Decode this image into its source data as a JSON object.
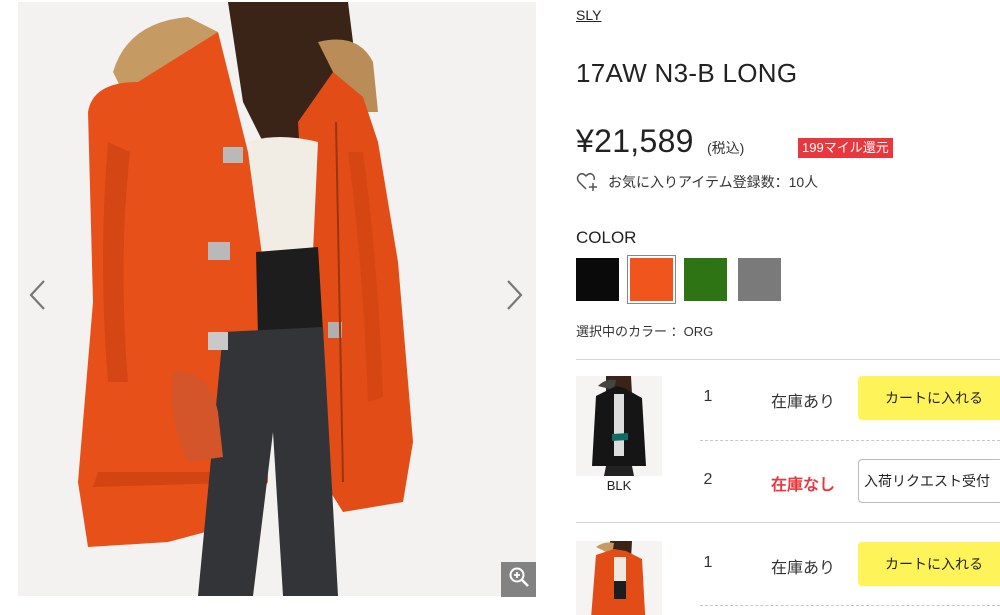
{
  "gallery": {
    "prev_icon": "chevron-left-icon",
    "next_icon": "chevron-right-icon",
    "zoom_icon": "zoom-in-icon"
  },
  "product": {
    "brand": "SLY",
    "title": "17AW N3-B LONG",
    "price": "¥21,589",
    "tax_note": "(税込)",
    "mile_badge": "199マイル還元",
    "favorite_text": "お気に入りアイテム登録数：10人",
    "favorite_icon": "heart-plus-icon"
  },
  "colors": {
    "label": "COLOR",
    "swatches": [
      {
        "name": "black",
        "hex": "#0a0a0a"
      },
      {
        "name": "orange",
        "hex": "#f0551e"
      },
      {
        "name": "green",
        "hex": "#2f7414"
      },
      {
        "name": "gray",
        "hex": "#7a7a7a"
      }
    ],
    "selected_text": "選択中のカラー ：ORG"
  },
  "variants": [
    {
      "color_label": "BLK",
      "sizes": [
        {
          "size": "1",
          "stock": "在庫あり",
          "action": "カートに入れる"
        },
        {
          "size": "2",
          "stock": "在庫なし",
          "action": "入荷リクエスト受付"
        }
      ]
    },
    {
      "color_label": "",
      "sizes": [
        {
          "size": "1",
          "stock": "在庫あり",
          "action": "カートに入れる"
        }
      ]
    }
  ],
  "accent_colors": {
    "cart_yellow": "#fff35a",
    "sold_out_red": "#e8383d",
    "coat_orange": "#e8501a"
  }
}
